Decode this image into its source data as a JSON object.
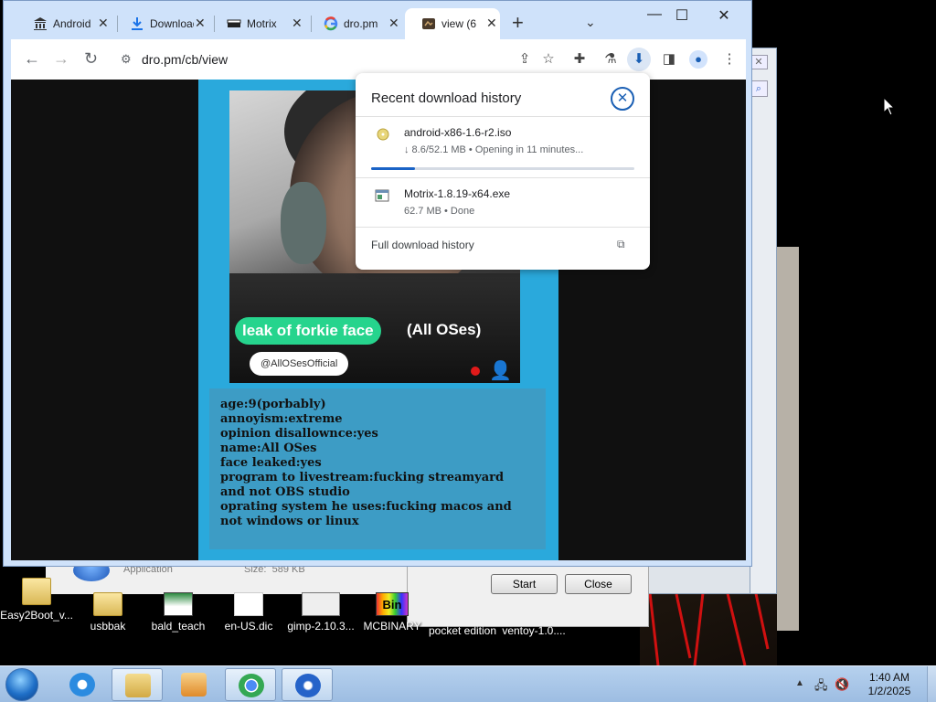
{
  "browser": {
    "tabs": [
      {
        "title": "Android",
        "icon": "museum-icon",
        "active": false
      },
      {
        "title": "Downloads",
        "icon": "download-icon",
        "active": false
      },
      {
        "title": "Motrix",
        "icon": "motrix-icon",
        "active": false
      },
      {
        "title": "dro.pm",
        "icon": "google-icon",
        "active": false
      },
      {
        "title": "view (6",
        "icon": "video-icon",
        "active": true
      }
    ],
    "url": "dro.pm/cb/view",
    "window_controls": {
      "minimize": "—",
      "maximize": "☐",
      "close": "✕"
    }
  },
  "page": {
    "video": {
      "caption_highlight": "leak of forkie face",
      "caption_rest": "(All OSes)",
      "handle": "@AllOSesOfficial"
    },
    "info_lines": [
      "age:9(porbably)",
      "annoyism:extreme",
      "opinion disallownce:yes",
      "name:All OSes",
      "face leaked:yes",
      "program to livestream:fucking streamyard",
      "and not OBS studio",
      "oprating system he uses:fucking macos and",
      "not windows or linux"
    ]
  },
  "downloads": {
    "title": "Recent download history",
    "items": [
      {
        "name": "android-x86-1.6-r2.iso",
        "status": "↓ 8.6/52.1 MB • Opening in 11 minutes...",
        "progress": 0.165,
        "icon": "disc-icon"
      },
      {
        "name": "Motrix-1.8.19-x64.exe",
        "status": "62.7 MB • Done",
        "icon": "exe-icon"
      }
    ],
    "full_history_label": "Full download history"
  },
  "background_dialog": {
    "app_type": "Application",
    "size_label": "Size:",
    "size_value": "589 KB",
    "start_label": "Start",
    "close_label": "Close"
  },
  "desktop_icons": [
    {
      "label": "Easy2Boot_v...",
      "type": "folder"
    },
    {
      "label": "usbbak",
      "type": "folder"
    },
    {
      "label": "bald_teach",
      "type": "image"
    },
    {
      "label": "en-US.dic",
      "type": "doc"
    },
    {
      "label": "gimp-2.10.3...",
      "type": "installer"
    },
    {
      "label": "MCBINARY",
      "type": "bin"
    },
    {
      "label": "pocket edition",
      "type": "app"
    },
    {
      "label": "ventoy-1.0....",
      "type": "app"
    }
  ],
  "taskbar": {
    "time": "1:40 AM",
    "date": "1/2/2025"
  },
  "colors": {
    "page_accent": "#2aa9dc",
    "progress": "#1a63c6",
    "caption_pill": "#26d48d"
  }
}
